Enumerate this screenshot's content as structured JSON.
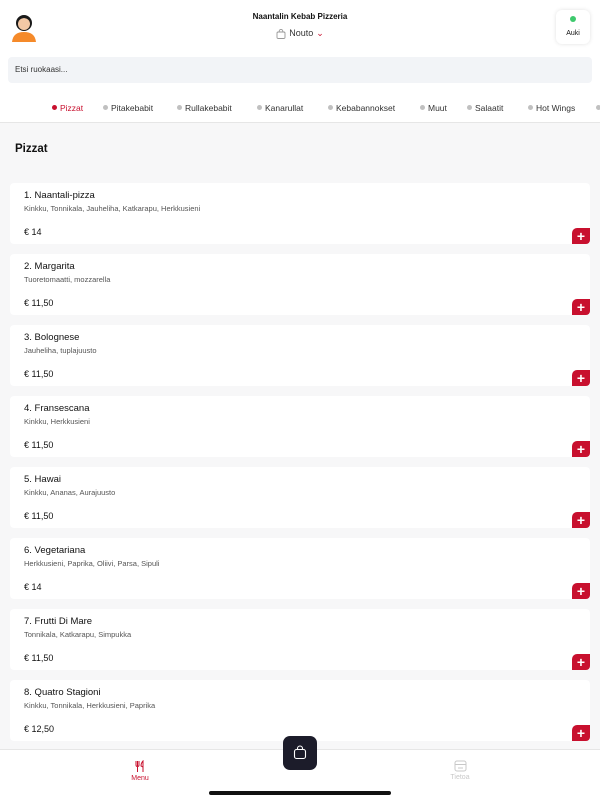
{
  "header": {
    "restaurant_name": "Naantalin Kebab Pizzeria",
    "order_mode": "Nouto",
    "status_label": "Auki"
  },
  "search": {
    "placeholder": "Etsi ruokaasi..."
  },
  "categories": [
    {
      "label": "Pizzat",
      "active": true
    },
    {
      "label": "Pitakebabit",
      "active": false
    },
    {
      "label": "Rullakebabit",
      "active": false
    },
    {
      "label": "Kanarullat",
      "active": false
    },
    {
      "label": "Kebabannokset",
      "active": false
    },
    {
      "label": "Muut",
      "active": false
    },
    {
      "label": "Salaatit",
      "active": false
    },
    {
      "label": "Hot Wings",
      "active": false
    }
  ],
  "section_title": "Pizzat",
  "items": [
    {
      "name": "1. Naantali-pizza",
      "description": "Kinkku, Tonnikala, Jauheliha, Katkarapu, Herkkusieni",
      "price": "€ 14"
    },
    {
      "name": "2. Margarita",
      "description": "Tuoretomaatti, mozzarella",
      "price": "€ 11,50"
    },
    {
      "name": "3. Bolognese",
      "description": "Jauheliha, tuplajuusto",
      "price": "€ 11,50"
    },
    {
      "name": "4. Fransescana",
      "description": "Kinkku, Herkkusieni",
      "price": "€ 11,50"
    },
    {
      "name": "5. Hawai",
      "description": "Kinkku, Ananas, Aurajuusto",
      "price": "€ 11,50"
    },
    {
      "name": "6. Vegetariana",
      "description": "Herkkusieni, Paprika, Oliivi, Parsa, Sipuli",
      "price": "€ 14"
    },
    {
      "name": "7. Frutti Di Mare",
      "description": "Tonnikala, Katkarapu, Simpukka",
      "price": "€ 11,50"
    },
    {
      "name": "8. Quatro Stagioni",
      "description": "Kinkku, Tonnikala, Herkkusieni, Paprika",
      "price": "€ 12,50"
    }
  ],
  "nav": {
    "menu_label": "Menu",
    "info_label": "Tietoa"
  },
  "colors": {
    "accent": "#c8102e",
    "open_status": "#3ec96d",
    "cart_button": "#1c1c2a"
  },
  "icons": {
    "avatar": "user-avatar-icon",
    "order_mode": "shopping-bag-icon",
    "add": "plus-icon",
    "menu": "fork-knife-icon",
    "info": "storefront-icon",
    "cart": "shopping-bag-icon"
  }
}
